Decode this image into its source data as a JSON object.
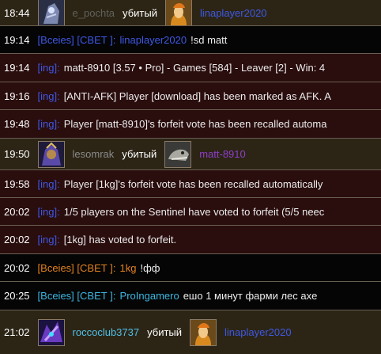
{
  "rows": [
    {
      "time": "18:44",
      "killer": {
        "name": "e_pochta"
      },
      "verb": "убитый",
      "victim": {
        "name": "linaplayer2020"
      }
    },
    {
      "time": "19:14",
      "channel": "[Всеіеѕ] [СВЕТ ]:",
      "sender": "linaplayer2020",
      "message": "!sd matt"
    },
    {
      "time": "19:14",
      "tag": "[ing]:",
      "message": "matt-8910 [3.57 • Pro] - Games [584] - Leaver [2] - Win: 4"
    },
    {
      "time": "19:16",
      "tag": "[ing]:",
      "message": "[ANTI-AFK] Player [download] has been marked as AFK. A"
    },
    {
      "time": "19:48",
      "tag": "[ing]:",
      "message": "Player [matt-8910]'s forfeit vote has been recalled automa"
    },
    {
      "time": "19:50",
      "killer": {
        "name": "lesomrak"
      },
      "verb": "убитый",
      "victim": {
        "name": "matt-8910"
      }
    },
    {
      "time": "19:58",
      "tag": "[ing]:",
      "message": "Player [1kg]'s forfeit vote has been recalled automatically"
    },
    {
      "time": "20:02",
      "tag": "[ing]:",
      "message": "1/5 players on the Sentinel have voted to forfeit (5/5 neec"
    },
    {
      "time": "20:02",
      "tag": "[ing]:",
      "message": "[1kg] has voted to forfeit."
    },
    {
      "time": "20:02",
      "channel": "[Вceіes] [СВЕТ ]:",
      "sender": "1kg",
      "message": "!фф"
    },
    {
      "time": "20:25",
      "channel": "[Вceіes] [СВЕТ ]:",
      "sender": "ProIngamero",
      "message": "ешо 1 минут фарми лес axe"
    },
    {
      "time": "21:02",
      "killer": {
        "name": "roccoclub3737"
      },
      "verb": "убитый",
      "victim": {
        "name": "linaplayer2020"
      }
    }
  ]
}
